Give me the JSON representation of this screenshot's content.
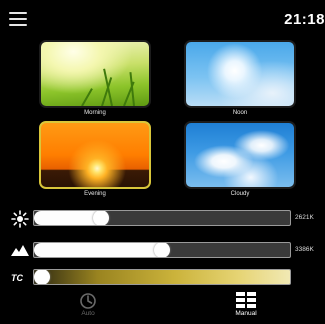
{
  "header": {
    "time": "21:18"
  },
  "presets": [
    {
      "label": "Morning",
      "selected": false
    },
    {
      "label": "Noon",
      "selected": false
    },
    {
      "label": "Evening",
      "selected": true
    },
    {
      "label": "Cloudy",
      "selected": false
    }
  ],
  "sliders": {
    "brightness": {
      "value_text": "2621K",
      "level": 0.26,
      "icon": "sun-icon"
    },
    "cct": {
      "value_text": "3386K",
      "level": 0.5,
      "icon": "hills-icon"
    },
    "tc": {
      "icon_text": "TC",
      "level": 0.02
    }
  },
  "tabs": [
    {
      "label": "Auto",
      "icon": "clock-icon",
      "active": false
    },
    {
      "label": "Manual",
      "icon": "grid-icon",
      "active": true
    }
  ],
  "colors": {
    "selected_border": "#d9c63a",
    "tab_active": "#ffffff",
    "tab_inactive": "#6a6a6a"
  }
}
